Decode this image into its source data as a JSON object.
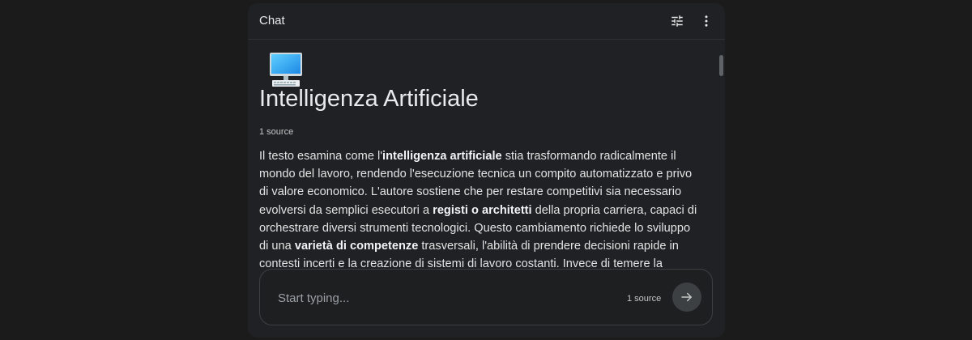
{
  "header": {
    "title": "Chat",
    "tune_icon": "tune-icon",
    "more_icon": "more-vert-icon"
  },
  "notebook": {
    "emoji_icon": "computer-icon",
    "title": "Intelligenza Artificiale",
    "source_count": "1 source",
    "summary": [
      {
        "text": "Il testo esamina come l'",
        "bold": false
      },
      {
        "text": "intelligenza artificiale",
        "bold": true
      },
      {
        "text": " stia trasformando radicalmente il mondo del lavoro, rendendo l'esecuzione tecnica un compito automatizzato e privo di valore economico. L'autore sostiene che per restare competitivi sia necessario evolversi da semplici esecutori a ",
        "bold": false
      },
      {
        "text": "registi o architetti",
        "bold": true
      },
      {
        "text": " della propria carriera, capaci di orchestrare diversi strumenti tecnologici. Questo cambiamento richiede lo sviluppo di una ",
        "bold": false
      },
      {
        "text": "varietà di competenze",
        "bold": true
      },
      {
        "text": " trasversali, l'abilità di prendere decisioni rapide in contesti incerti e la creazione di sistemi di lavoro costanti. Invece di temere la",
        "bold": false
      }
    ],
    "scroll_down_icon": "chevron-down-icon"
  },
  "composer": {
    "placeholder": "Start typing...",
    "source_count": "1 source",
    "send_icon": "arrow-right-icon"
  },
  "colors": {
    "background": "#1b1b1c",
    "panel": "#202124",
    "text": "#e3e3e3"
  }
}
